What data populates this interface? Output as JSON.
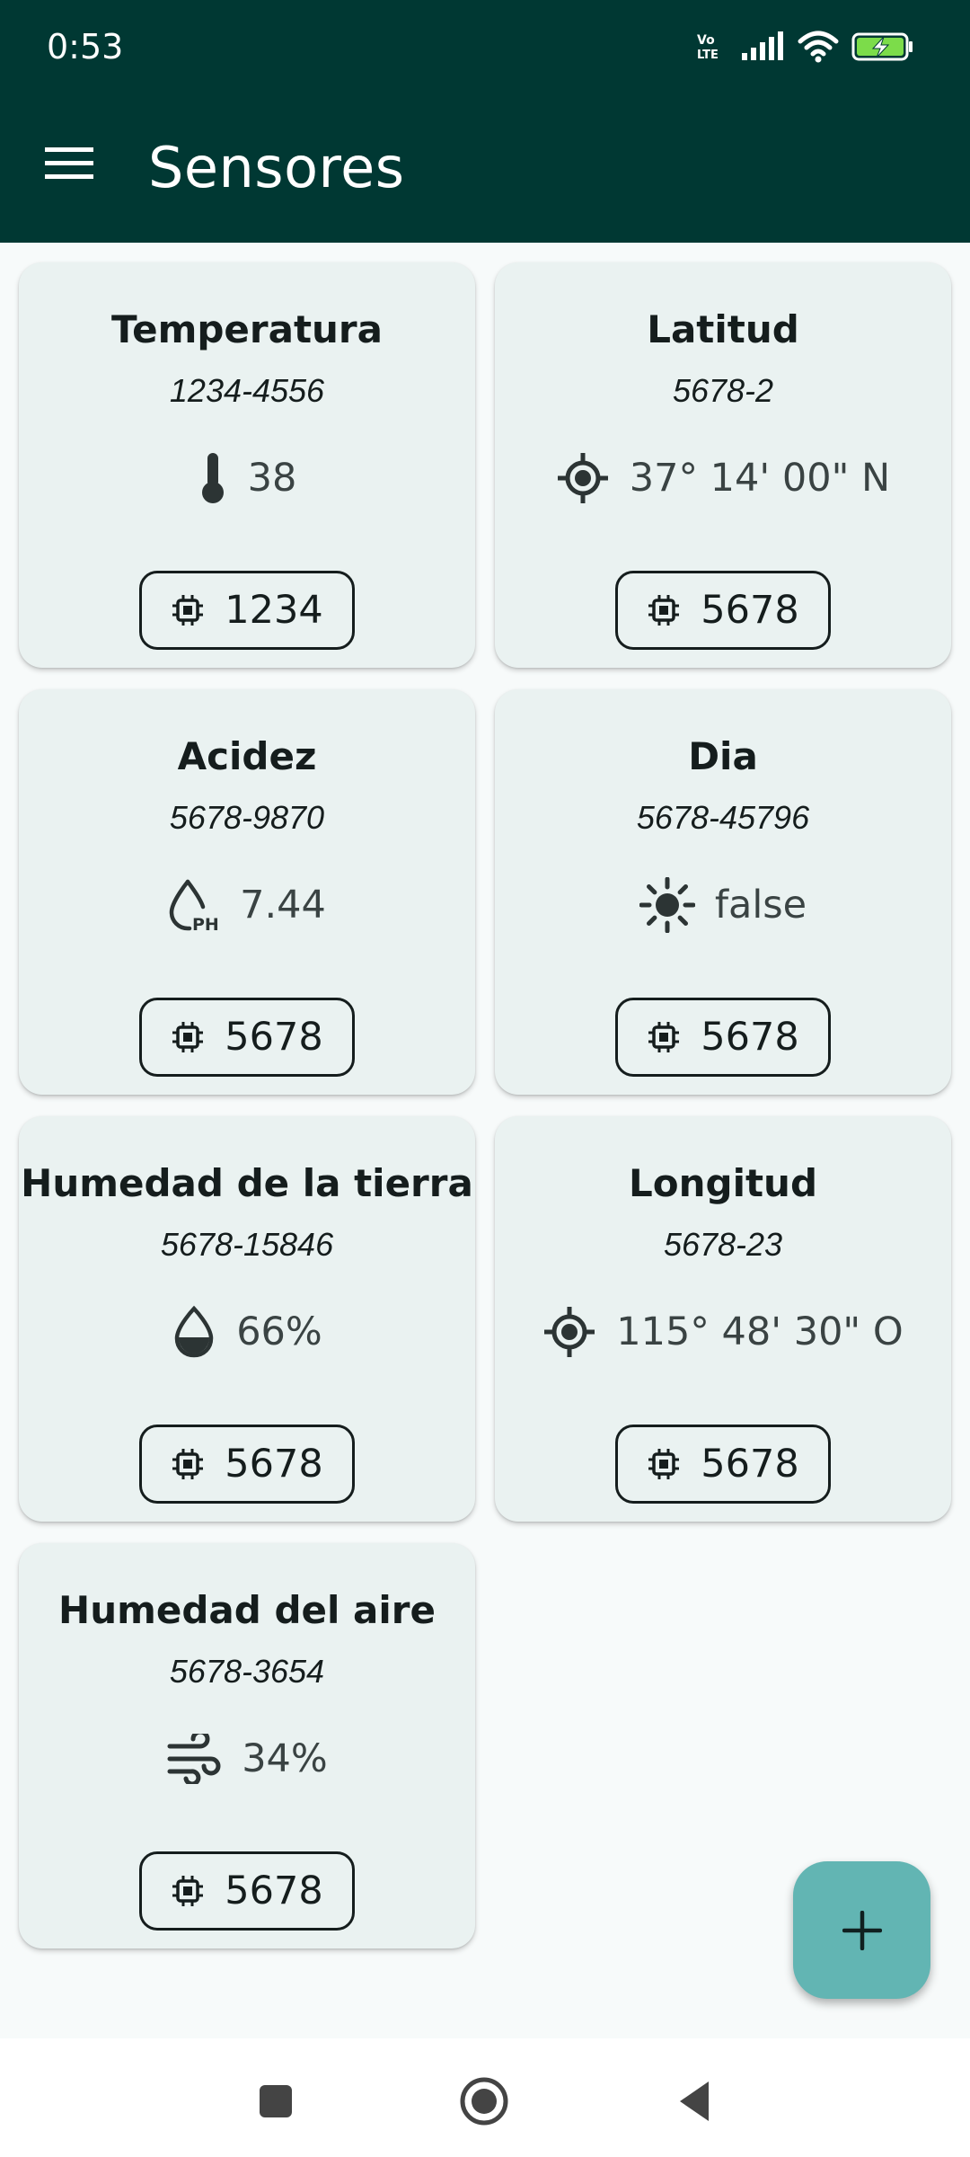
{
  "status_bar": {
    "time": "0:53",
    "icons": [
      "volte-icon",
      "signal-icon",
      "wifi-icon",
      "battery-charging-icon"
    ],
    "volte_label": "Vo LTE"
  },
  "app_bar": {
    "title": "Sensores",
    "menu_icon": "menu-icon"
  },
  "sensors": [
    {
      "name": "Temperatura",
      "serial": "1234-4556",
      "icon": "thermometer-icon",
      "value": "38",
      "device": "1234"
    },
    {
      "name": "Latitud",
      "serial": "5678-2",
      "icon": "location-icon",
      "value": "37° 14' 00\" N",
      "device": "5678"
    },
    {
      "name": "Acidez",
      "serial": "5678-9870",
      "icon": "ph-icon",
      "value": "7.44",
      "device": "5678"
    },
    {
      "name": "Dia",
      "serial": "5678-45796",
      "icon": "sun-icon",
      "value": "false",
      "device": "5678"
    },
    {
      "name": "Humedad de la tierra",
      "serial": "5678-15846",
      "icon": "water-drop-icon",
      "value": "66%",
      "device": "5678"
    },
    {
      "name": "Longitud",
      "serial": "5678-23",
      "icon": "location-icon",
      "value": "115° 48' 30\" O",
      "device": "5678"
    },
    {
      "name": "Humedad del aire",
      "serial": "5678-3654",
      "icon": "air-icon",
      "value": "34%",
      "device": "5678"
    }
  ],
  "fab": {
    "label": "+",
    "icon": "add-icon"
  },
  "nav_bar": {
    "buttons": [
      "recents-button",
      "home-button",
      "back-button"
    ]
  },
  "colors": {
    "primary_dark": "#003833",
    "card_bg": "#eaf2f1",
    "fab_bg": "#62b5b3",
    "text": "#151d1d"
  }
}
